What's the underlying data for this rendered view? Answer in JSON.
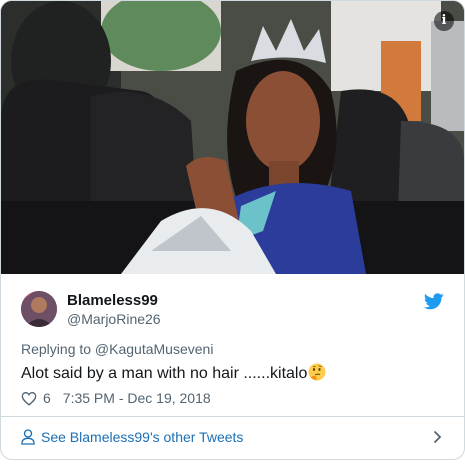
{
  "tweet": {
    "media": {
      "icon": "info-icon",
      "info_glyph": "i"
    },
    "author": {
      "display_name": "Blameless99",
      "handle": "@MarjoRine26",
      "avatar_icon": "avatar"
    },
    "brand_icon": "twitter-bird-icon",
    "replying_to": "Replying to @KagutaMuseveni",
    "text": "Alot said by a man with no hair ......kitalo",
    "emoji": "thinking-face-emoji",
    "likes": "6",
    "timestamp": "7:35 PM - Dec 19, 2018",
    "footer_link": "See Blameless99's other Tweets"
  },
  "colors": {
    "link": "#1b6fb5",
    "twitter_blue": "#1d9bf0",
    "secondary_text": "#536471",
    "border": "#cfd9de"
  }
}
